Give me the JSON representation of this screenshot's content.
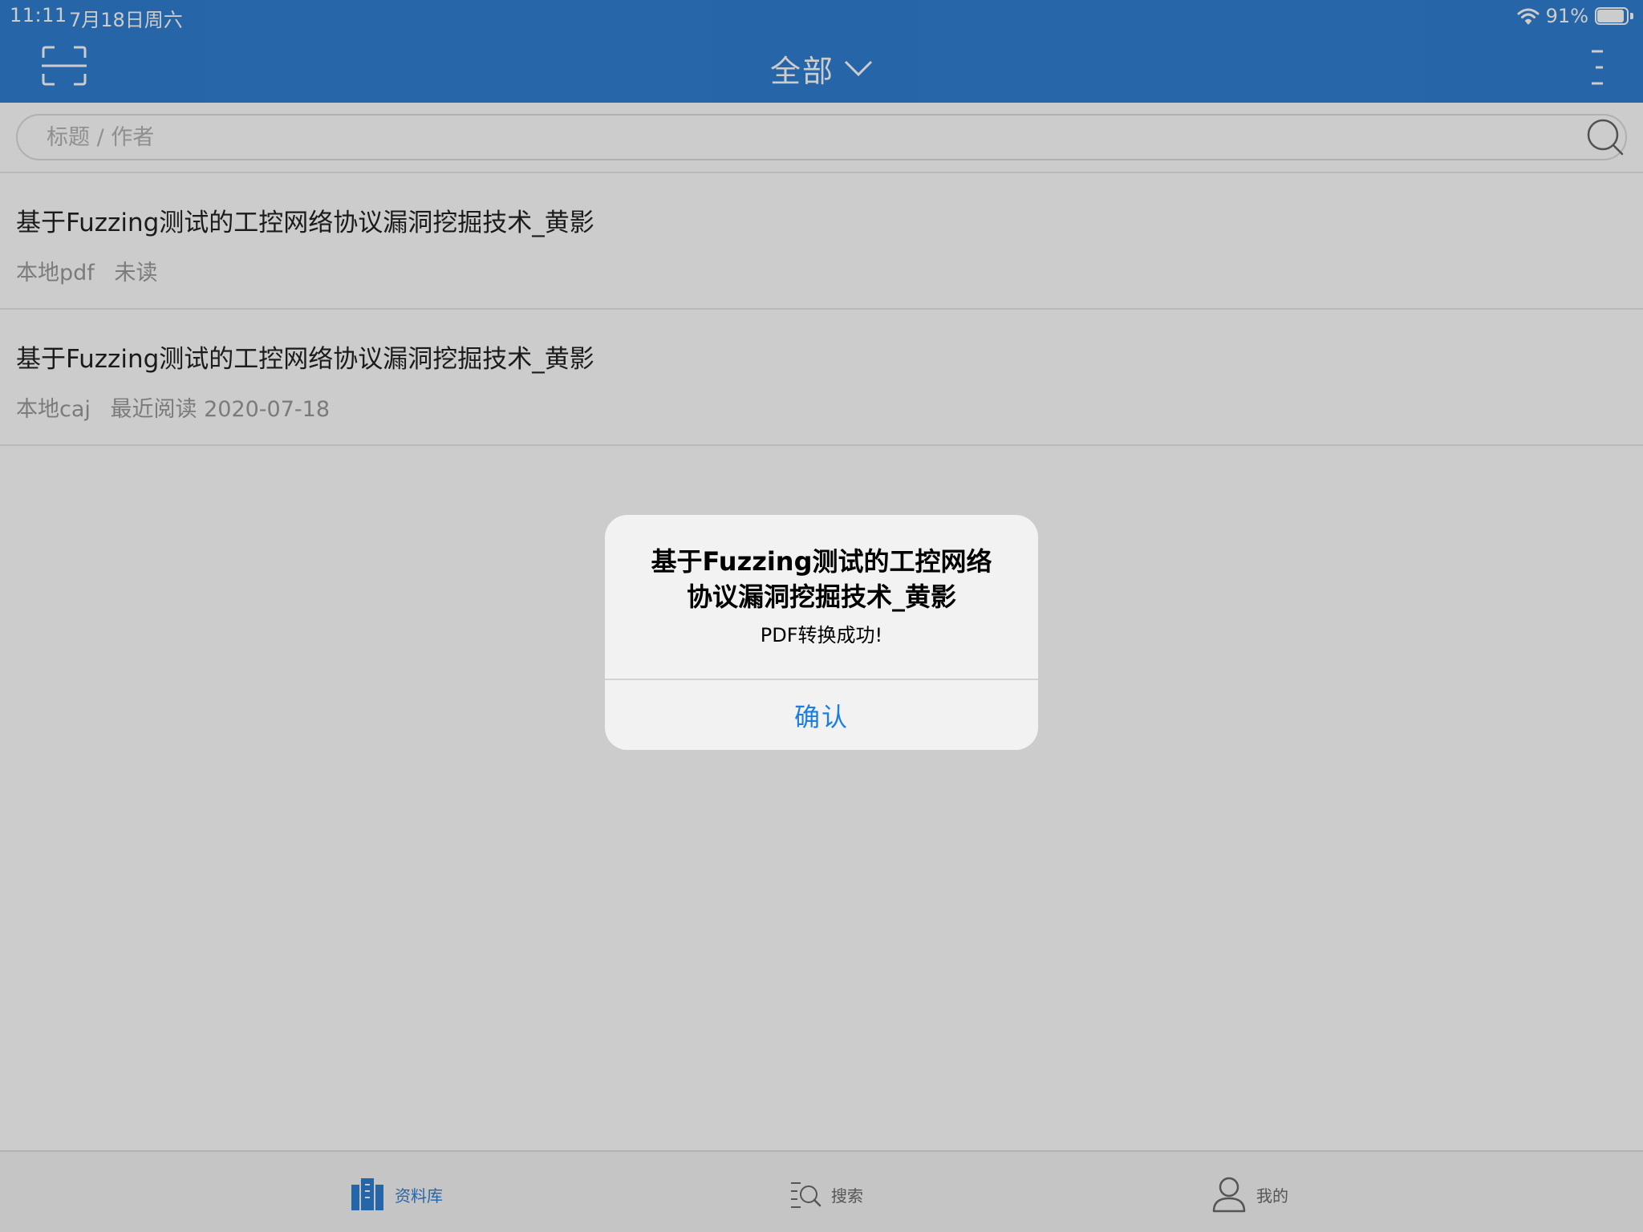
{
  "status_bar": {
    "time": "11:11",
    "date": "7月18日周六",
    "battery_percent": "91%",
    "battery_level": 0.91
  },
  "nav": {
    "title": "全部"
  },
  "search": {
    "placeholder": "标题 / 作者"
  },
  "documents": [
    {
      "title": "基于Fuzzing测试的工控网络协议漏洞挖掘技术_黄影",
      "source": "本地pdf",
      "status": "未读"
    },
    {
      "title": "基于Fuzzing测试的工控网络协议漏洞挖掘技术_黄影",
      "source": "本地caj",
      "status": "最近阅读 2020-07-18"
    }
  ],
  "alert": {
    "title_line1": "基于Fuzzing测试的工控网络",
    "title_line2": "协议漏洞挖掘技术_黄影",
    "message": "PDF转换成功!",
    "confirm_label": "确认"
  },
  "tab_bar": {
    "items": [
      {
        "label": "资料库",
        "icon": "library-icon",
        "active": true
      },
      {
        "label": "搜索",
        "icon": "search-list-icon",
        "active": false
      },
      {
        "label": "我的",
        "icon": "user-icon",
        "active": false
      }
    ]
  },
  "colors": {
    "header": "#2f7fd3",
    "accent": "#1a7fe0",
    "alert_bg": "#f2f2f2"
  }
}
